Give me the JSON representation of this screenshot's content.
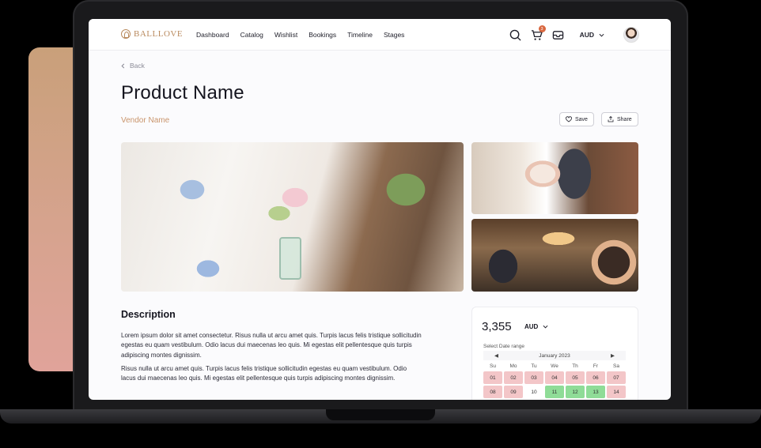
{
  "brand": {
    "name": "BALLLOVE",
    "color": "#b98a5e"
  },
  "nav": {
    "items": [
      "Dashboard",
      "Catalog",
      "Wishlist",
      "Bookings",
      "Timeline",
      "Stages"
    ],
    "cart_count": "3",
    "currency": "AUD"
  },
  "page": {
    "back_label": "Back",
    "title": "Product  Name",
    "vendor": "Vendor Name",
    "save_label": "Save",
    "share_label": "Share"
  },
  "description": {
    "heading": "Description",
    "paragraphs": [
      "Lorem ipsum dolor sit amet consectetur. Risus nulla ut arcu amet quis. Turpis lacus felis tristique sollicitudin egestas eu quam vestibulum. Odio lacus dui maecenas leo quis. Mi egestas elit pellentesque quis turpis adipiscing montes dignissim.",
      "Risus nulla ut arcu amet quis. Turpis lacus felis tristique sollicitudin egestas eu quam vestibulum. Odio lacus dui maecenas leo quis. Mi egestas elit pellentesque quis turpis adipiscing montes dignissim."
    ]
  },
  "booking": {
    "price": "3,355",
    "currency": "AUD",
    "date_label": "Select Date range",
    "month": "January 2023",
    "weekdays": [
      "Su",
      "Mo",
      "Tu",
      "We",
      "Th",
      "Fr",
      "Sa"
    ],
    "week1": [
      "01",
      "02",
      "03",
      "04",
      "05",
      "06",
      "07"
    ],
    "week2": [
      "08",
      "09",
      "10",
      "11",
      "12",
      "13",
      "14"
    ]
  },
  "colors": {
    "accent": "#c9946b",
    "badge": "#d9673f",
    "unavailable": "#f3c6c8",
    "available": "#8fdc97"
  }
}
